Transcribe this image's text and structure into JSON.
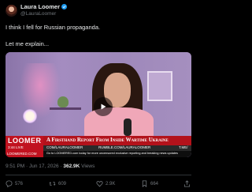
{
  "author": {
    "name": "Laura Loomer",
    "handle": "@LauraLoomer",
    "verified_color": "#1d9bf0"
  },
  "post": {
    "line1": "I think I fell for Russian propaganda.",
    "line2": "Let me explain..."
  },
  "video": {
    "logo": "LOOMER",
    "clock": "3:44",
    "live": "LIVE",
    "headline": "A Firsthand Report From Inside Wartime Ukraine",
    "com_url": "COM/LAURALOOMER",
    "rumble": "RUMBLE.COM/LAURALOOMER",
    "twitter": "T.ME/",
    "ticker_label": "LOOMERED.COM",
    "ticker_text": "Go to LOOMERED.com today for more uncensored exclusive reporting and breaking news updates",
    "accent": "#c1121f"
  },
  "meta": {
    "time": "9:51 PM",
    "date": "Jun 17, 2026",
    "views": "362.9K",
    "views_label": "Views"
  },
  "actions": {
    "replies": "576",
    "reposts": "609",
    "likes": "2.9K",
    "bookmarks": "664"
  }
}
